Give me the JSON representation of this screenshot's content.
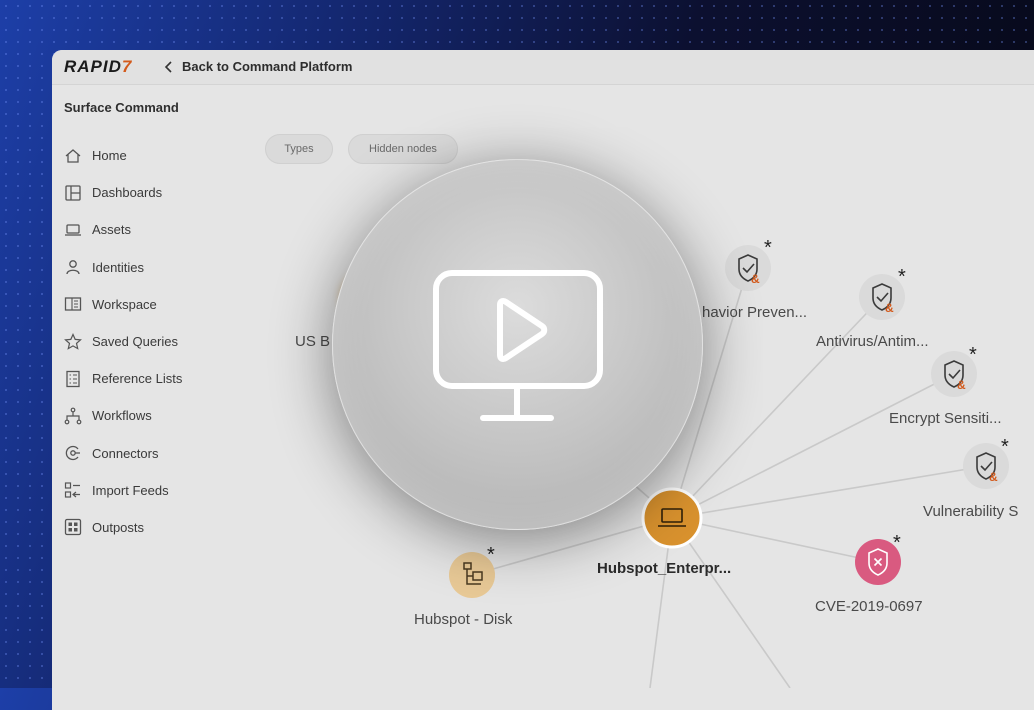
{
  "topbar": {
    "logo_main": "RAPID",
    "logo_accent": "7",
    "back_label": "Back to Command Platform"
  },
  "sidebar": {
    "product": "Surface Command",
    "items": [
      {
        "label": "Home",
        "icon": "home-icon"
      },
      {
        "label": "Dashboards",
        "icon": "dashboard-icon"
      },
      {
        "label": "Assets",
        "icon": "laptop-icon"
      },
      {
        "label": "Identities",
        "icon": "user-icon"
      },
      {
        "label": "Workspace",
        "icon": "book-icon"
      },
      {
        "label": "Saved Queries",
        "icon": "star-icon"
      },
      {
        "label": "Reference Lists",
        "icon": "list-icon"
      },
      {
        "label": "Workflows",
        "icon": "workflow-icon"
      },
      {
        "label": "Connectors",
        "icon": "connector-icon"
      },
      {
        "label": "Import Feeds",
        "icon": "import-icon"
      },
      {
        "label": "Outposts",
        "icon": "outpost-icon"
      }
    ]
  },
  "filters": {
    "types": "Types",
    "hidden_nodes": "Hidden nodes"
  },
  "graph": {
    "center_label": "Hubspot_Enterpr...",
    "nodes": [
      {
        "label": "Hubspot - Disk",
        "icon": "disk-icon",
        "star": "*"
      },
      {
        "label": "CVE-2019-0697",
        "icon": "shield-x-icon",
        "star": "*"
      },
      {
        "label": "havior Preven...",
        "icon": "shield-check-icon",
        "star": "*"
      },
      {
        "label": "Antivirus/Antim...",
        "icon": "shield-check-icon",
        "star": "*"
      },
      {
        "label": "Encrypt Sensiti...",
        "icon": "shield-check-icon",
        "star": "*"
      },
      {
        "label": "Vulnerability S",
        "icon": "shield-check-icon",
        "star": "*"
      },
      {
        "label": "US B",
        "icon": "",
        "star": ""
      }
    ]
  },
  "player": {
    "icon": "monitor-play-icon"
  },
  "colors": {
    "accent_orange": "#d9922e",
    "cve_pink": "#d95a80",
    "logo_seven": "#d35a1c"
  }
}
